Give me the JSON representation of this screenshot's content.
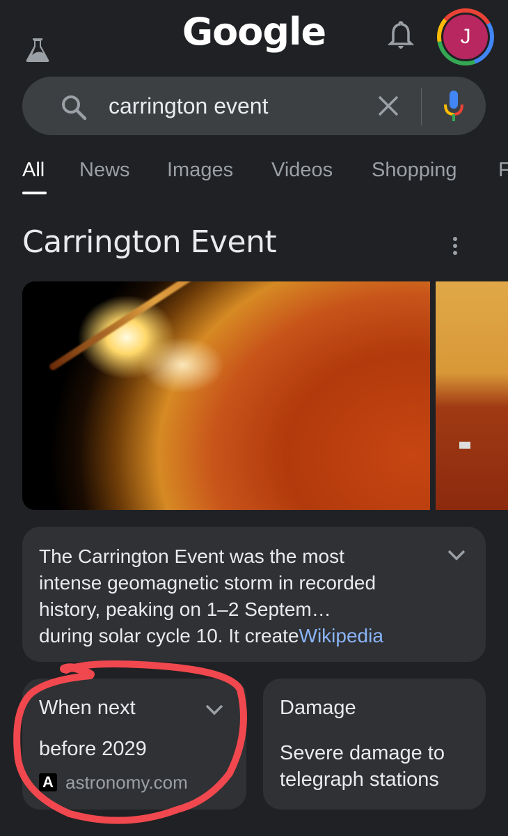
{
  "header": {
    "labs_icon": "flask-icon",
    "logo": "Google",
    "notifications_icon": "bell-icon",
    "avatar_initial": "J",
    "avatar_color": "#b8275f"
  },
  "search": {
    "query": "carrington event",
    "search_icon": "search-icon",
    "clear_icon": "close-icon",
    "voice_icon": "mic-icon"
  },
  "tabs": [
    {
      "label": "All",
      "active": true
    },
    {
      "label": "News",
      "active": false
    },
    {
      "label": "Images",
      "active": false
    },
    {
      "label": "Videos",
      "active": false
    },
    {
      "label": "Shopping",
      "active": false
    },
    {
      "label": "F",
      "active": false
    }
  ],
  "knowledge_panel": {
    "title": "Carrington Event",
    "more_icon": "more-vert-icon",
    "images": [
      {
        "alt": "Solar flare image"
      },
      {
        "alt": "Sun with spacecraft illustration"
      }
    ],
    "description": {
      "line1": "The Carrington Event was the most",
      "line2": "intense geomagnetic storm in recorded",
      "line3": "history, peaking on 1–2 Septem…",
      "line4": "during solar cycle 10. It create",
      "source_link": "Wikipedia"
    },
    "cards": [
      {
        "title": "When next",
        "value": "before 2029",
        "source": "astronomy.com",
        "source_logo": "A",
        "expandable": true
      },
      {
        "title": "Damage",
        "value_line1": "Severe damage to",
        "value_line2": "telegraph stations"
      }
    ]
  },
  "annotation": {
    "type": "hand-drawn circle",
    "color": "#f0484e",
    "target": "When next card"
  }
}
